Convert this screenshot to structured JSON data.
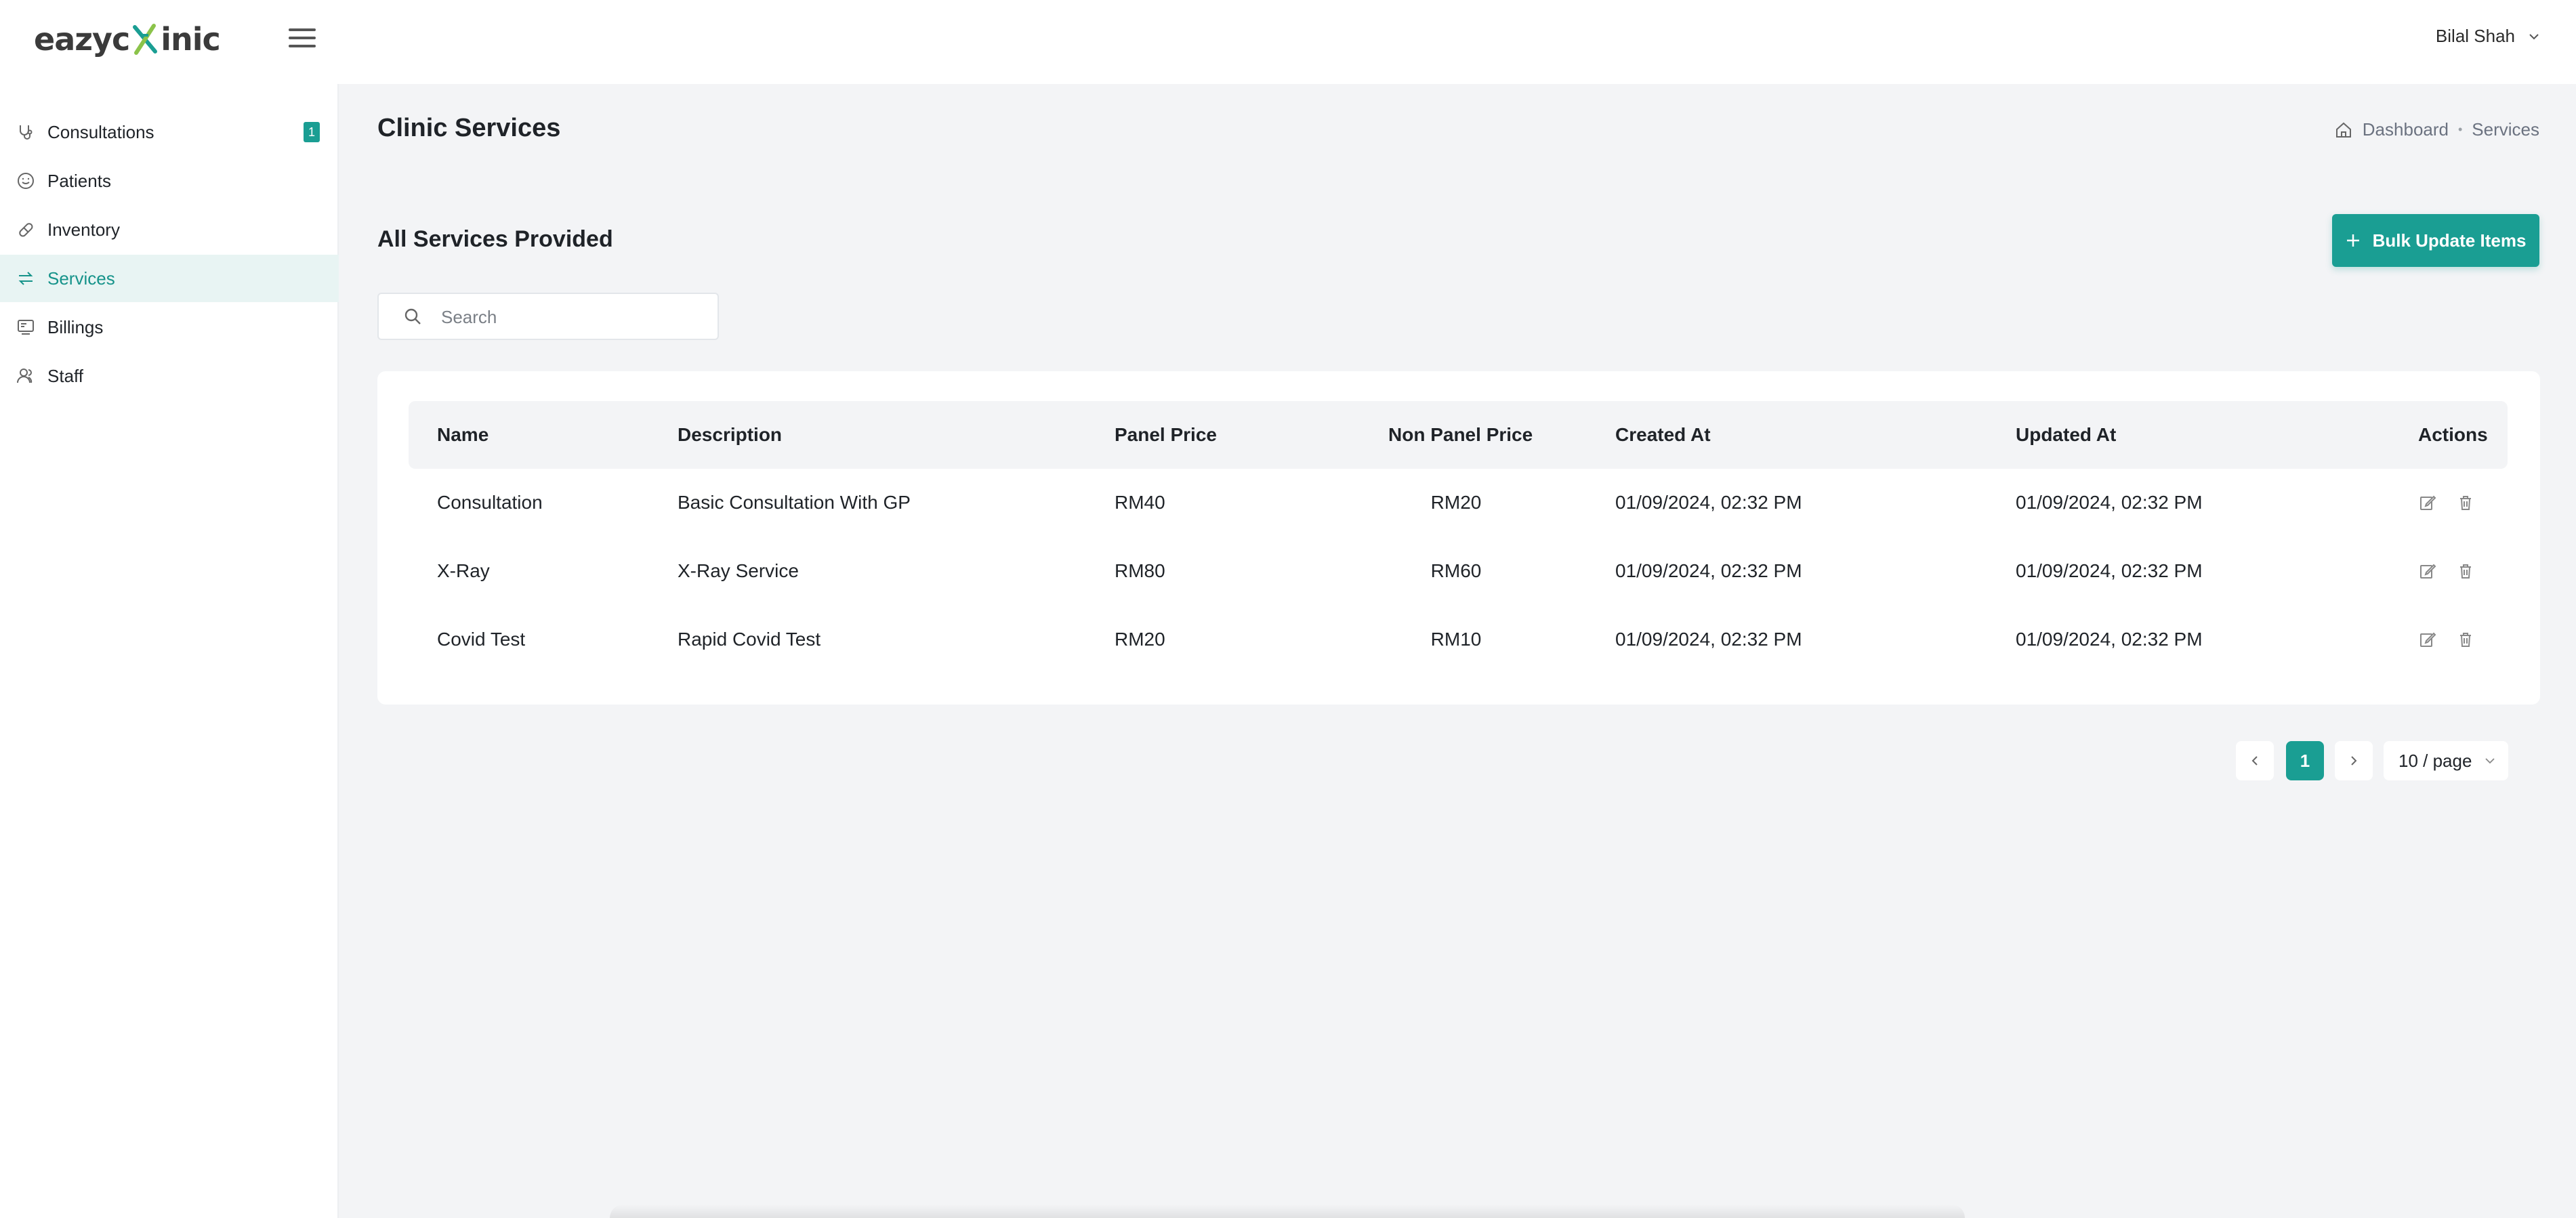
{
  "app": {
    "logo_text_left": "eazyc",
    "logo_text_right": "inic"
  },
  "header": {
    "user_name": "Bilal Shah"
  },
  "sidebar": {
    "items": [
      {
        "label": "Consultations",
        "icon": "stethoscope-icon",
        "badge": "1",
        "active": false
      },
      {
        "label": "Patients",
        "icon": "smile-face-icon",
        "active": false
      },
      {
        "label": "Inventory",
        "icon": "pill-icon",
        "active": false
      },
      {
        "label": "Services",
        "icon": "swap-icon",
        "active": true
      },
      {
        "label": "Billings",
        "icon": "billing-icon",
        "active": false
      },
      {
        "label": "Staff",
        "icon": "staff-icon",
        "active": false
      }
    ]
  },
  "page": {
    "title": "Clinic Services",
    "breadcrumb": [
      "Dashboard",
      "Services"
    ]
  },
  "section": {
    "title": "All Services Provided",
    "bulk_button": "Bulk Update Items"
  },
  "search": {
    "placeholder": "Search",
    "value": ""
  },
  "table": {
    "columns": [
      "Name",
      "Description",
      "Panel Price",
      "Non Panel Price",
      "Created At",
      "Updated At",
      "Actions"
    ],
    "rows": [
      [
        "Consultation",
        "Basic Consultation With GP",
        "RM40",
        "RM20",
        "01/09/2024, 02:32 PM",
        "01/09/2024, 02:32 PM"
      ],
      [
        "X-Ray",
        "X-Ray Service",
        "RM80",
        "RM60",
        "01/09/2024, 02:32 PM",
        "01/09/2024, 02:32 PM"
      ],
      [
        "Covid Test",
        "Rapid Covid Test",
        "RM20",
        "RM10",
        "01/09/2024, 02:32 PM",
        "01/09/2024, 02:32 PM"
      ]
    ]
  },
  "pagination": {
    "current_page": "1",
    "page_size": "10 / page"
  },
  "colors": {
    "accent": "#1a9e93",
    "active_nav_bg": "#e8f4f3",
    "page_bg": "#f3f4f6"
  }
}
